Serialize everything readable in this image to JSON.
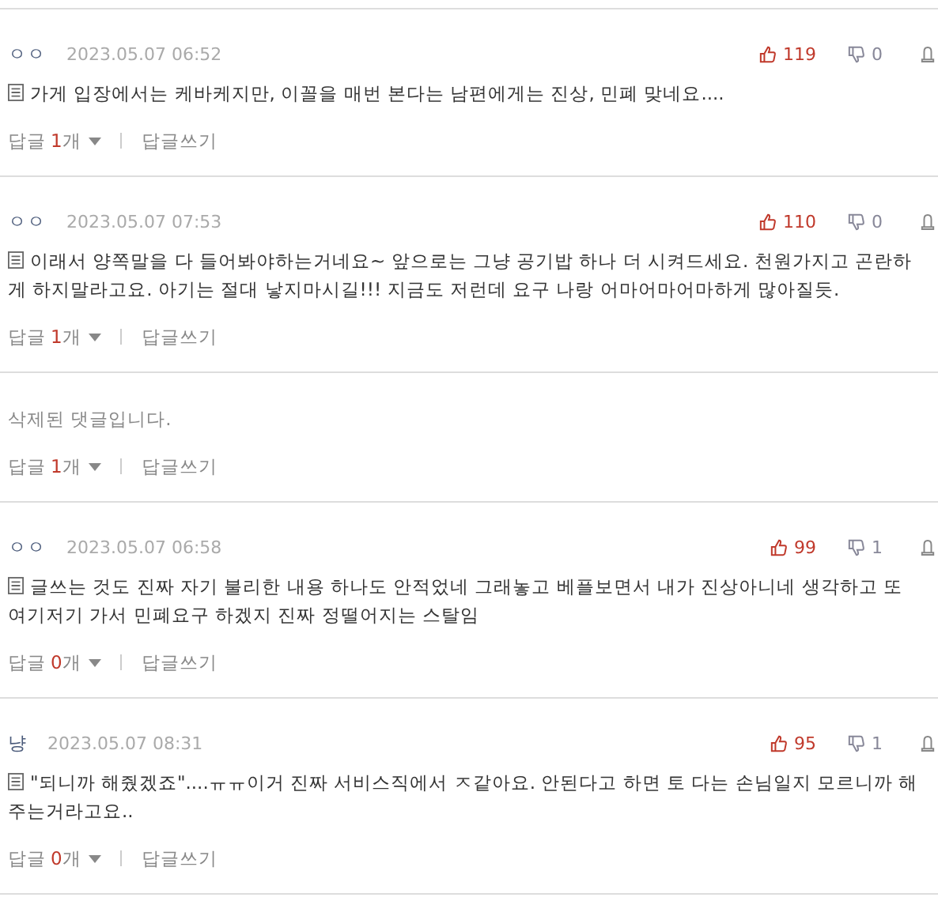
{
  "comments": [
    {
      "kind": "normal",
      "author": "ㅇㅇ",
      "date": "2023.05.07 06:52",
      "likes": "119",
      "dislikes": "0",
      "text": "가게 입장에서는 케바케지만, 이꼴을 매번 본다는 남편에게는 진상, 민폐 맞네요....",
      "reply_prefix": "답글",
      "reply_count": "1",
      "reply_suffix": "개",
      "write_reply": "답글쓰기"
    },
    {
      "kind": "normal",
      "author": "ㅇㅇ",
      "date": "2023.05.07 07:53",
      "likes": "110",
      "dislikes": "0",
      "text": "이래서 양쪽말을 다 들어봐야하는거네요~ 앞으로는 그냥 공기밥 하나 더 시켜드세요. 천원가지고 곤란하게 하지말라고요. 아기는 절대 낳지마시길!!! 지금도 저런데 요구 나랑 어마어마어마하게 많아질듯.",
      "reply_prefix": "답글",
      "reply_count": "1",
      "reply_suffix": "개",
      "write_reply": "답글쓰기"
    },
    {
      "kind": "deleted",
      "text": "삭제된 댓글입니다.",
      "reply_prefix": "답글",
      "reply_count": "1",
      "reply_suffix": "개",
      "write_reply": "답글쓰기"
    },
    {
      "kind": "normal",
      "author": "ㅇㅇ",
      "date": "2023.05.07 06:58",
      "likes": "99",
      "dislikes": "1",
      "text": "글쓰는 것도 진짜 자기 불리한 내용 하나도 안적었네 그래놓고 베플보면서 내가 진상아니네 생각하고 또 여기저기 가서 민폐요구 하겠지 진짜 정떨어지는 스탈임",
      "reply_prefix": "답글",
      "reply_count": "0",
      "reply_suffix": "개",
      "write_reply": "답글쓰기"
    },
    {
      "kind": "normal",
      "author": "냥",
      "date": "2023.05.07 08:31",
      "likes": "95",
      "dislikes": "1",
      "text": "\"되니까 해줬겠죠\"....ㅠㅠ이거 진짜 서비스직에서 ㅈ같아요. 안된다고 하면 토 다는 손님일지 모르니까 해주는거라고요..",
      "reply_prefix": "답글",
      "reply_count": "0",
      "reply_suffix": "개",
      "write_reply": "답글쓰기"
    }
  ]
}
